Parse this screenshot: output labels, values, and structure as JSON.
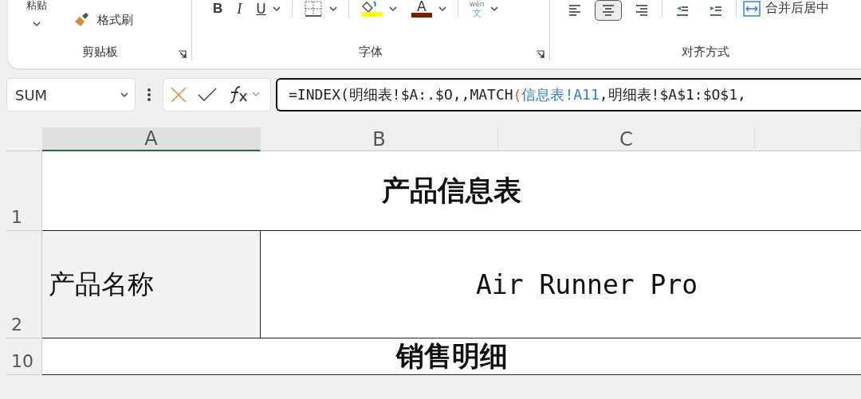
{
  "ribbon": {
    "groups": [
      {
        "kind": "clipboard",
        "label": "剪贴板",
        "paste": "粘贴",
        "painter": "格式刷"
      },
      {
        "kind": "font",
        "label": "字体",
        "tools": [
          {
            "kind": "bold",
            "text": "B"
          },
          {
            "kind": "italic",
            "text": "I"
          },
          {
            "kind": "underline",
            "text": "U"
          },
          {
            "kind": "border"
          },
          {
            "kind": "fill",
            "color": "#ffff00"
          },
          {
            "kind": "fontcolor",
            "text": "A",
            "color": "#7b1c00"
          },
          {
            "kind": "phonetic",
            "text": "wén",
            "sub": "文"
          }
        ]
      },
      {
        "kind": "align",
        "label": "对齐方式",
        "buttons": [
          {
            "kind": "left",
            "selected": false
          },
          {
            "kind": "center",
            "selected": true
          },
          {
            "kind": "right",
            "selected": false
          },
          {
            "kind": "outdent",
            "selected": false
          },
          {
            "kind": "indent",
            "selected": false
          }
        ],
        "merge": "合并后居中"
      }
    ]
  },
  "formula_bar": {
    "name_box": "SUM",
    "formula": [
      {
        "text": "=INDEX(明细表!$A:.$O,,MATCH",
        "color": "#222222"
      },
      {
        "text": "(",
        "color": "#c8722c"
      },
      {
        "text": "信息表!A11",
        "color": "#2f7fd0"
      },
      {
        "text": ",明细表!$A$1:$O$1,",
        "color": "#222222"
      }
    ]
  },
  "sheet": {
    "columns": [
      {
        "label": "A",
        "selected": true
      },
      {
        "label": "B",
        "selected": false
      },
      {
        "label": "C",
        "selected": false
      }
    ],
    "rows": [
      {
        "number": "1",
        "cells": [
          {
            "kind": "title",
            "text": "产品信息表",
            "colspan": 3
          }
        ]
      },
      {
        "number": "2",
        "cells": [
          {
            "kind": "label",
            "text": "产品名称"
          },
          {
            "kind": "value",
            "text": "Air Runner Pro",
            "colspan": 2
          }
        ]
      },
      {
        "number": "10",
        "cells": [
          {
            "kind": "title",
            "text": "销售明细",
            "colspan": 3
          }
        ]
      }
    ]
  }
}
